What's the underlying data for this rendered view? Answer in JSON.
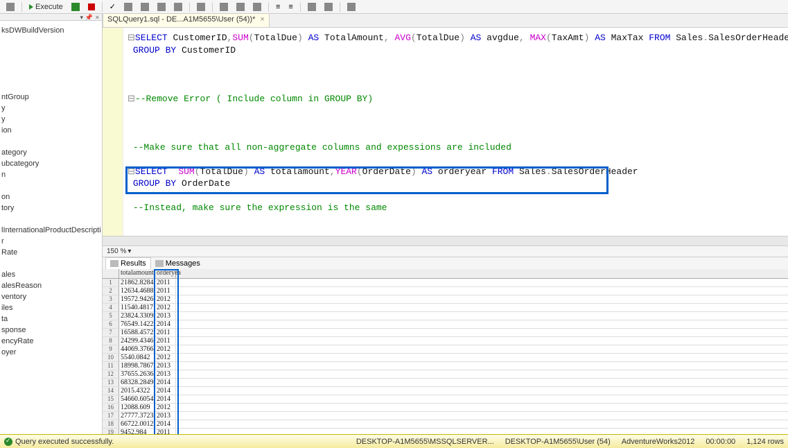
{
  "toolbar": {
    "execute": "Execute"
  },
  "sidebar": {
    "items": [
      "ksDWBuildVersion",
      "",
      "",
      "",
      "",
      "",
      "ntGroup",
      "y",
      "y",
      "ion",
      "",
      "ategory",
      "ubcategory",
      "n",
      "",
      "on",
      "tory",
      "",
      "lInternationalProductDescription",
      "r",
      "Rate",
      "",
      "ales",
      "alesReason",
      "ventory",
      "iles",
      "ta",
      "sponse",
      "encyRate",
      "oyer"
    ]
  },
  "tab": {
    "title": "SQLQuery1.sql - DE...A1M5655\\User (54))*",
    "close": "×"
  },
  "code": {
    "l1a": "SELECT",
    "l1b": " CustomerID",
    "l1c": ",",
    "l1d": "SUM",
    "l1e": "(",
    "l1f": "TotalDue",
    "l1g": ")",
    "l1h": " AS ",
    "l1i": "TotalAmount",
    "l1j": ", ",
    "l1k": "AVG",
    "l1l": "(",
    "l1m": "TotalDue",
    "l1n": ")",
    "l1o": " AS ",
    "l1p": "avgdue",
    "l1q": ", ",
    "l1r": "MAX",
    "l1s": "(",
    "l1t": "TaxAmt",
    "l1u": ")",
    "l1v": " AS ",
    "l1w": "MaxTax",
    "l1x": " FROM ",
    "l1y": "Sales",
    "l1z": ".",
    "l1aa": "SalesOrderHeader",
    "l2a": "GROUP",
    "l2b": " BY ",
    "l2c": "CustomerID",
    "l3": "--Remove Error ( Include column in GROUP BY)",
    "l4": "--Make sure that all non-aggregate columns and expessions are included",
    "l5a": "SELECT",
    "l5b": "  ",
    "l5c": "SUM",
    "l5d": "(",
    "l5e": "TotalDue",
    "l5f": ")",
    "l5g": " AS ",
    "l5h": "totalamount",
    "l5i": ",",
    "l5j": "YEAR",
    "l5k": "(",
    "l5l": "OrderDate",
    "l5m": ")",
    "l5n": " AS ",
    "l5o": "orderyear",
    "l5p": " FROM ",
    "l5q": "Sales",
    "l5r": ".",
    "l5s": "SalesOrderHeader",
    "l6a": "GROUP",
    "l6b": " BY ",
    "l6c": "OrderDate",
    "l7": "--Instead, make sure the expression is the same"
  },
  "zoom": "150 %",
  "results": {
    "tab_results": "Results",
    "tab_messages": "Messages",
    "columns": [
      "totalamount",
      "orderyea"
    ],
    "rows": [
      {
        "n": "1",
        "a": "21862.8284",
        "y": "2011"
      },
      {
        "n": "2",
        "a": "12634.4688",
        "y": "2011"
      },
      {
        "n": "3",
        "a": "19572.9426",
        "y": "2012"
      },
      {
        "n": "4",
        "a": "11540.4817",
        "y": "2012"
      },
      {
        "n": "5",
        "a": "23824.3309",
        "y": "2013"
      },
      {
        "n": "6",
        "a": "76549.1422",
        "y": "2014"
      },
      {
        "n": "7",
        "a": "16588.4572",
        "y": "2011"
      },
      {
        "n": "8",
        "a": "24299.4346",
        "y": "2011"
      },
      {
        "n": "9",
        "a": "44069.3766",
        "y": "2012"
      },
      {
        "n": "10",
        "a": "5540.0842",
        "y": "2012"
      },
      {
        "n": "11",
        "a": "18998.7867",
        "y": "2013"
      },
      {
        "n": "12",
        "a": "37655.2636",
        "y": "2013"
      },
      {
        "n": "13",
        "a": "68328.2849",
        "y": "2014"
      },
      {
        "n": "14",
        "a": "2015.4322",
        "y": "2014"
      },
      {
        "n": "15",
        "a": "54660.6054",
        "y": "2014"
      },
      {
        "n": "16",
        "a": "12088.609",
        "y": "2012"
      },
      {
        "n": "17",
        "a": "27777.3723",
        "y": "2013"
      },
      {
        "n": "18",
        "a": "66722.0012",
        "y": "2014"
      },
      {
        "n": "19",
        "a": "9452.984",
        "y": "2011"
      }
    ]
  },
  "status": {
    "msg": "Query executed successfully.",
    "server": "DESKTOP-A1M5655\\MSSQLSERVER...",
    "user": "DESKTOP-A1M5655\\User (54)",
    "db": "AdventureWorks2012",
    "time": "00:00:00",
    "rows": "1,124 rows"
  }
}
